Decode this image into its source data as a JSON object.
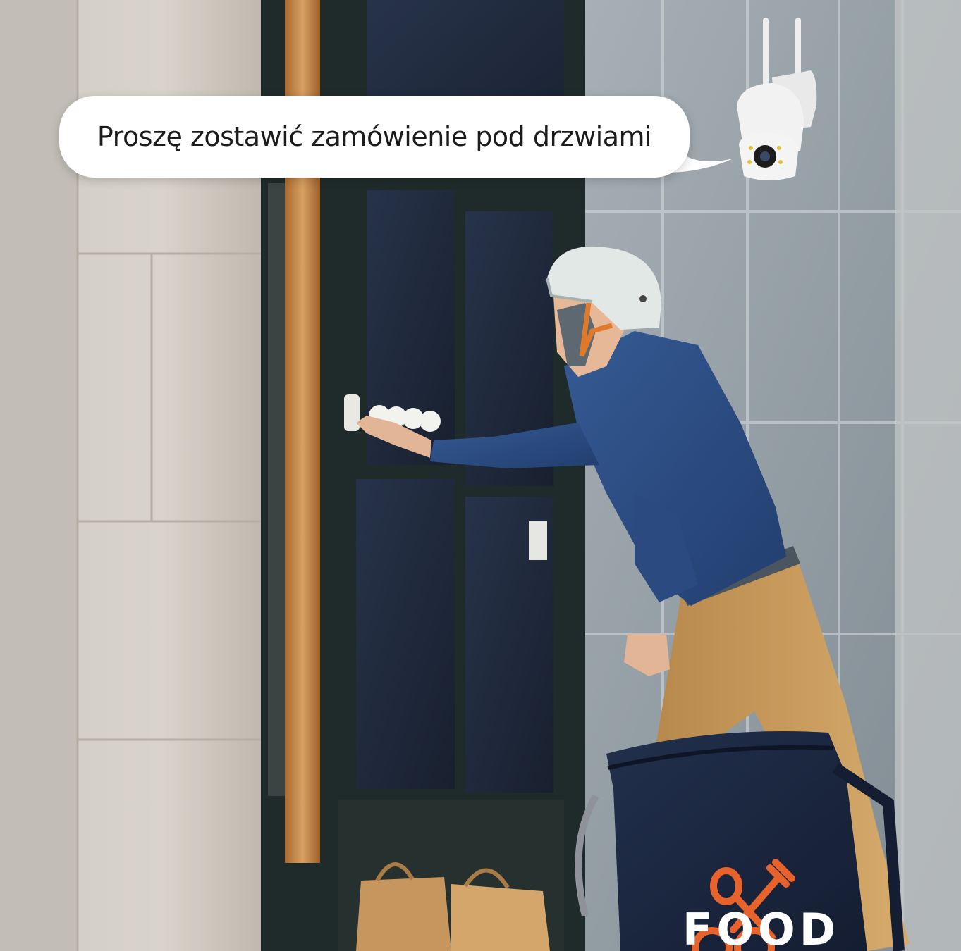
{
  "speech_bubble": {
    "text": "Proszę zostawić zamówienie pod drzwiami"
  },
  "delivery_bag": {
    "logo_text": "FOOD",
    "logo_icon": "fork-and-spoon-cross-icon",
    "logo_color": "#e8622c"
  },
  "colors": {
    "jacket": "#2d4e86",
    "trousers": "#c79a5a",
    "helmet": "#dde4e2",
    "bag": "#1c2a45",
    "wall_stone": "#d3cdc3",
    "wall_tile": "#8f9aa2",
    "door_frame": "#1e2a29",
    "wood_pole": "#c78a4a"
  },
  "camera": {
    "icon": "security-camera-icon"
  }
}
